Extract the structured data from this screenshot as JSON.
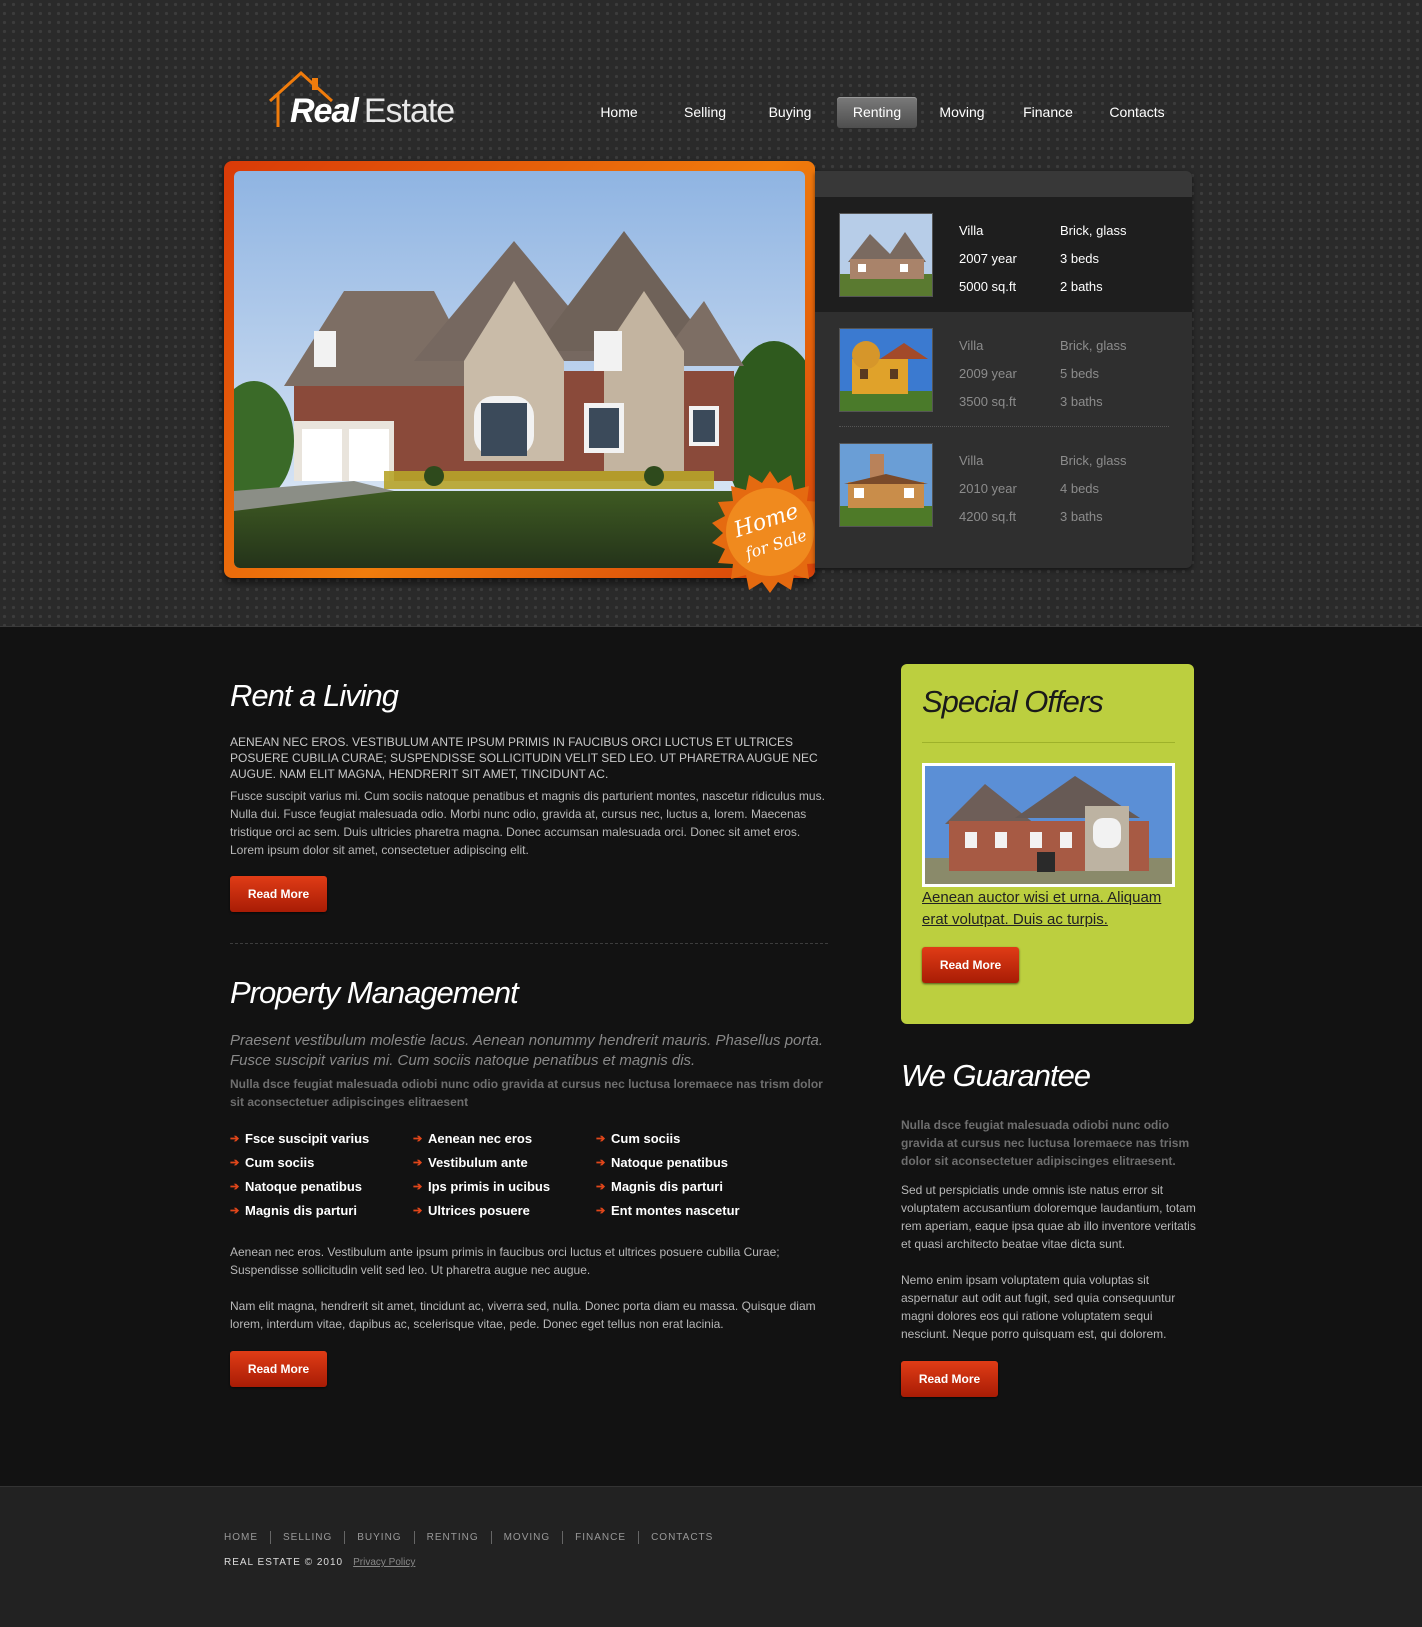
{
  "brand": {
    "word1": "Real",
    "word2": "Estate"
  },
  "nav": {
    "items": [
      "Home",
      "Selling",
      "Buying",
      "Renting",
      "Moving",
      "Finance",
      "Contacts"
    ],
    "active": "Renting"
  },
  "hero": {
    "badge_line1": "Home",
    "badge_line2": "for Sale"
  },
  "listings": [
    {
      "type": "Villa",
      "year": "2007 year",
      "area": "5000 sq.ft",
      "material": "Brick, glass",
      "beds": "3 beds",
      "baths": "2 baths"
    },
    {
      "type": "Villa",
      "year": "2009 year",
      "area": "3500 sq.ft",
      "material": "Brick, glass",
      "beds": "5 beds",
      "baths": "3 baths"
    },
    {
      "type": "Villa",
      "year": "2010 year",
      "area": "4200 sq.ft",
      "material": "Brick, glass",
      "beds": "4 beds",
      "baths": "3 baths"
    }
  ],
  "rent": {
    "title": "Rent a Living",
    "caps": "AENEAN NEC EROS. VESTIBULUM ANTE IPSUM PRIMIS IN FAUCIBUS ORCI LUCTUS ET ULTRICES POSUERE CUBILIA CURAE; SUSPENDISSE SOLLICITUDIN VELIT SED LEO. UT PHARETRA AUGUE NEC AUGUE. NAM ELIT MAGNA, HENDRERIT SIT AMET, TINCIDUNT AC.",
    "body": "Fusce suscipit varius mi. Cum sociis natoque penatibus et magnis dis parturient montes, nascetur ridiculus mus. Nulla dui. Fusce feugiat malesuada odio. Morbi nunc odio, gravida at, cursus nec, luctus a, lorem. Maecenas tristique orci ac sem. Duis ultricies pharetra magna. Donec accumsan malesuada orci. Donec sit amet eros. Lorem ipsum dolor sit amet, consectetuer adipiscing elit.",
    "button": "Read More"
  },
  "property": {
    "title": "Property Management",
    "lead": "Praesent vestibulum molestie lacus. Aenean nonummy hendrerit mauris. Phasellus porta. Fusce suscipit varius mi. Cum sociis natoque penatibus et magnis dis.",
    "bold": "Nulla dsce feugiat malesuada odiobi nunc odio gravida at cursus nec luctusa loremaece nas trism dolor sit aconsectetuer adipiscinges elitraesent",
    "links": [
      [
        "Fsce suscipit varius",
        "Cum sociis",
        "Natoque penatibus",
        "Magnis dis parturi"
      ],
      [
        "Aenean nec eros",
        "Vestibulum ante",
        "Ips primis in ucibus",
        "Ultrices posuere"
      ],
      [
        "Cum sociis",
        "Natoque penatibus",
        "Magnis dis parturi",
        "Ent montes nascetur"
      ]
    ],
    "para1": "Aenean nec eros. Vestibulum ante ipsum primis in faucibus orci luctus et ultrices posuere cubilia Curae; Suspendisse sollicitudin velit sed leo. Ut pharetra augue nec augue.",
    "para2": "Nam elit magna, hendrerit sit amet, tincidunt ac, viverra sed, nulla. Donec porta diam eu massa. Quisque diam lorem, interdum vitae, dapibus ac, scelerisque vitae, pede. Donec eget tellus non erat lacinia.",
    "button": "Read More"
  },
  "offers": {
    "title": "Special Offers",
    "link": "Aenean auctor wisi et urna. Aliquam erat volutpat. Duis ac turpis.",
    "button": "Read More"
  },
  "guarantee": {
    "title": "We Guarantee",
    "bold": "Nulla dsce feugiat malesuada odiobi nunc odio gravida at cursus nec luctusa loremaece nas trism dolor sit aconsectetuer adipiscinges elitraesent.",
    "para1": "Sed ut perspiciatis unde omnis iste natus error sit voluptatem accusantium doloremque laudantium, totam rem aperiam, eaque ipsa quae ab illo inventore veritatis et quasi architecto beatae vitae dicta sunt.",
    "para2": "Nemo enim ipsam voluptatem quia voluptas sit aspernatur aut odit aut fugit, sed quia consequuntur magni dolores eos qui ratione voluptatem sequi nesciunt. Neque porro quisquam est, qui dolorem.",
    "button": "Read More"
  },
  "footer": {
    "nav": [
      "HOME",
      "SELLING",
      "BUYING",
      "RENTING",
      "MOVING",
      "FINANCE",
      "CONTACTS"
    ],
    "copyright": "REAL ESTATE © 2010",
    "privacy": "Privacy Policy"
  }
}
